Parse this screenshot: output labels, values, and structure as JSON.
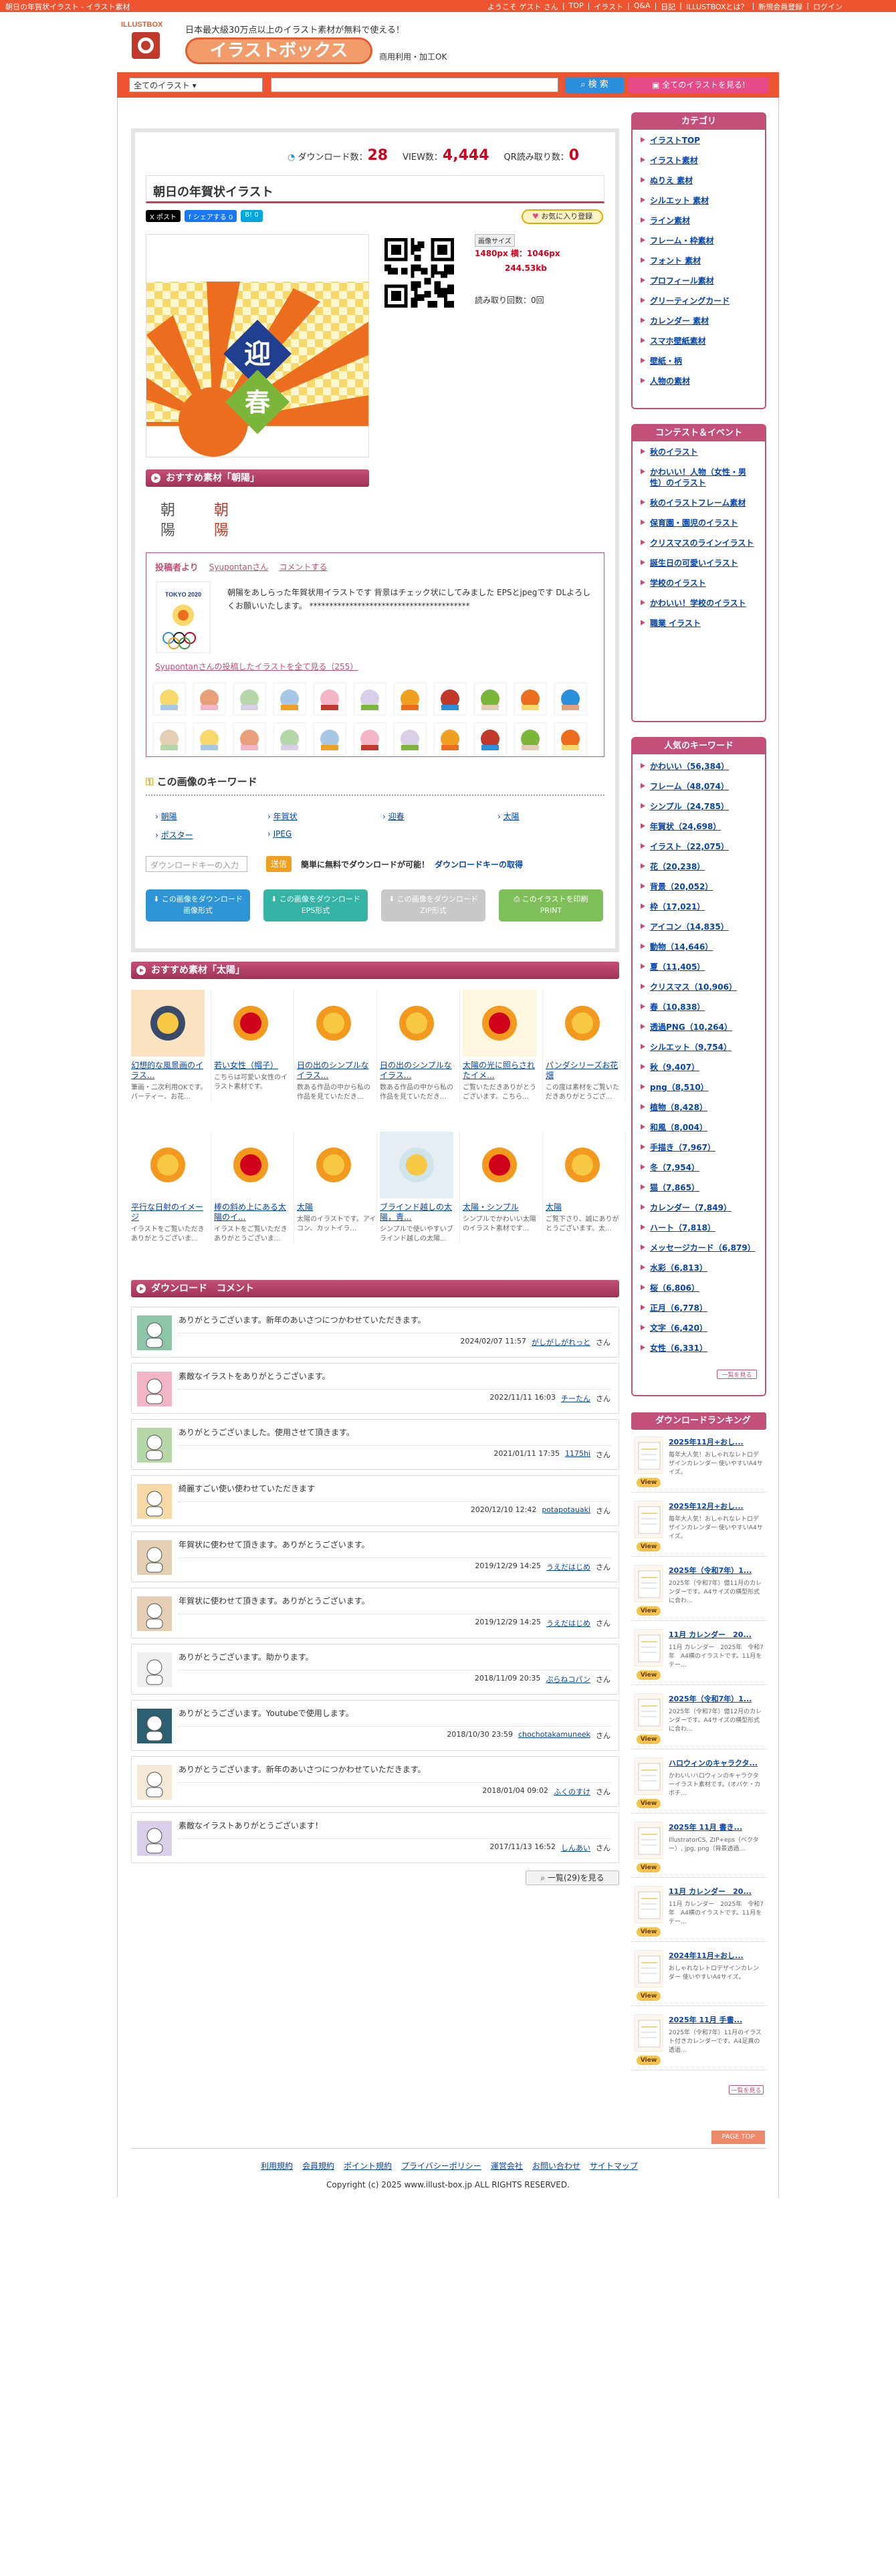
{
  "topbar": {
    "left": "朝日の年賀状イラスト - イラスト素材",
    "links": [
      "ようこそ ゲスト さん",
      "TOP",
      "イラスト",
      "Q&A",
      "日記",
      "ILLUSTBOXとは？",
      "新規会員登録",
      "ログイン"
    ]
  },
  "header": {
    "logo": "ILLUSTBOX",
    "tagline": "日本最大級30万点以上のイラスト素材が無料で使える！",
    "title": "イラストボックス",
    "sub": "商用利用・加工OK"
  },
  "search": {
    "category": "全てのイラスト",
    "button": "検 索",
    "see_all": "全てのイラストを見る!"
  },
  "stats": {
    "download_label": "ダウンロード数：",
    "download": "28",
    "view_label": "VIEW数：",
    "view": "4,444",
    "qr_label": "QR読み取り数：",
    "qr": "0"
  },
  "illustration": {
    "title": "朝日の年賀状イラスト",
    "fav": "お気に入り登録",
    "size_label": "画像サイズ",
    "size": "1480px 横：1046px",
    "kb": "244.53kb",
    "rank": "読み取り回数：0回",
    "img_text1": "迎",
    "img_text2": "春"
  },
  "social": [
    "X ポスト",
    "f シェアする 0",
    "B! 0"
  ],
  "recommend": {
    "title": "おすすめ素材「朝陽」"
  },
  "poster": {
    "title": "投稿者より",
    "name": "Syupontanさん",
    "comment_link": "コメントする",
    "text": "朝陽をあしらった年賀状用イラストです 背景はチェック状にしてみました EPSとjpegです DLよろしくお願いいたします。 ****************************************",
    "more": "Syupontanさんの投稿したイラストを全て見る（255）",
    "avatar_label": "TOKYO 2020"
  },
  "keywords": {
    "title": "この画像のキーワード",
    "items": [
      "朝陽",
      "年賀状",
      "迎春",
      "太陽",
      "ポスター",
      "JPEG"
    ],
    "input_placeholder": "ダウンロードキーの入力",
    "go": "送信",
    "note": "簡単に無料でダウンロードが可能！",
    "note_link": "ダウンロードキーの取得"
  },
  "downloads": [
    {
      "l1": "この画像をダウンロード",
      "l2": "画像形式",
      "c": "#2e96d6"
    },
    {
      "l1": "この画像をダウンロード",
      "l2": "EPS形式",
      "c": "#35b3a4"
    },
    {
      "l1": "この画像をダウンロード",
      "l2": "ZIP形式",
      "c": "#c8c8c8"
    },
    {
      "l1": "このイラストを印刷",
      "l2": "PRINT",
      "c": "#7fbf5a"
    }
  ],
  "sun": {
    "title": "おすすめ素材「太陽」",
    "cards": [
      {
        "t": "幻想的な風景画のイラス...",
        "d": "筆画・二次利用OKです。パーティー、お花..."
      },
      {
        "t": "若い女性（帽子）",
        "d": "こちらは可愛い女性のイラスト素材です。"
      },
      {
        "t": "日の出のシンプルなイラス...",
        "d": "数ある作品の中から私の作品を見ていただき..."
      },
      {
        "t": "日の出のシンプルなイラス...",
        "d": "数ある作品の中から私の作品を見ていただき..."
      },
      {
        "t": "太陽の光に照らされたイメ...",
        "d": "ご覧いただきありがとうございます。こちら..."
      },
      {
        "t": "パンダシリーズお花畑",
        "d": "この度は素材をご覧いただきありがとうござ..."
      },
      {
        "t": "平行な日射のイメージ",
        "d": "イラストをご覧いただきありがとうございま..."
      },
      {
        "t": "棒の斜め上にある太陽のイ...",
        "d": "イラストをご覧いただきありがとうございま..."
      },
      {
        "t": "太陽",
        "d": "太陽のイラストです。アイコン、カットイラ..."
      },
      {
        "t": "ブラインド越しの太陽，青...",
        "d": "シンプルで使いやすいブラインド越しの太陽..."
      },
      {
        "t": "太陽・シンプル",
        "d": "シンプルでかわいい太陽のイラスト素材です..."
      },
      {
        "t": "太陽",
        "d": "ご覧下さり、誠にありがとうございます。太..."
      }
    ]
  },
  "comments": {
    "title": "ダウンロード　コメント",
    "san": "さん",
    "more": "一覧(29)を見る",
    "items": [
      {
        "t": "ありがとうございます。新年のあいさつにつかわせていただきます。",
        "date": "2024/02/07 11:57",
        "u": "がしがしがれっと",
        "c": "#8cc5a8"
      },
      {
        "t": "素敵なイラストをありがとうございます。",
        "date": "2022/11/11 16:03",
        "u": "チーたん",
        "c": "#f4b5c6"
      },
      {
        "t": "ありがとうございました。使用させて頂きます。",
        "date": "2021/01/11 17:35",
        "u": "1175hi",
        "c": "#b6d7a8"
      },
      {
        "t": "綺麗すごい使い使わせていただきます",
        "date": "2020/12/10 12:42",
        "u": "potapotauaki",
        "c": "#f7d9a8"
      },
      {
        "t": "年賀状に使わせて頂きます。ありがとうございます。",
        "date": "2019/12/29 14:25",
        "u": "うえだはじめ",
        "c": "#e4cfb4"
      },
      {
        "t": "年賀状に使わせて頂きます。ありがとうございます。",
        "date": "2019/12/29 14:25",
        "u": "うえだはじめ",
        "c": "#e4cfb4"
      },
      {
        "t": "ありがとうございます。助かります。",
        "date": "2018/11/09 20:35",
        "u": "ぷらねコパン",
        "c": "#f0f0f0"
      },
      {
        "t": "ありがとうございます。Youtubeで使用します。",
        "date": "2018/10/30 23:59",
        "u": "chochotakamuneek",
        "c": "#2d5f73"
      },
      {
        "t": "ありがとうございます。新年のあいさつにつかわせていただきます。",
        "date": "2018/01/04 09:02",
        "u": "ふくのすけ",
        "c": "#f5e8d6"
      },
      {
        "t": "素敵なイラストありがとうございます！",
        "date": "2017/11/13 16:52",
        "u": "しんあい",
        "c": "#d9cfe8"
      }
    ]
  },
  "sidebar": {
    "category": {
      "title": "カテゴリ",
      "items": [
        "イラストTOP",
        "イラスト素材",
        "ぬりえ 素材",
        "シルエット 素材",
        "ライン素材",
        "フレーム・枠素材",
        "フォント 素材",
        "プロフィール素材",
        "グリーティングカード",
        "カレンダー 素材",
        "スマホ壁紙素材",
        "壁紙・柄",
        "人物の素材"
      ]
    },
    "events": {
      "title": "コンテスト＆イベント",
      "items": [
        "秋のイラスト",
        "かわいい！人物（女性・男性）のイラスト",
        "秋のイラストフレーム素材",
        "保育園・園児のイラスト",
        "クリスマスのラインイラスト",
        "誕生日の可愛いイラスト",
        "学校のイラスト",
        "かわいい！学校のイラスト",
        "職業 イラスト"
      ]
    },
    "popular": {
      "title": "人気のキーワード",
      "items": [
        "かわいい（56,384）",
        "フレーム（48,074）",
        "シンプル（24,785）",
        "年賀状（24,698）",
        "イラスト（22,075）",
        "花（20,238）",
        "背景（20,052）",
        "枠（17,021）",
        "アイコン（14,835）",
        "動物（14,646）",
        "夏（11,405）",
        "クリスマス（10,906）",
        "春（10,838）",
        "透過PNG（10,264）",
        "シルエット（9,754）",
        "秋（9,407）",
        "png（8,510）",
        "植物（8,428）",
        "和風（8,004）",
        "手描き（7,967）",
        "冬（7,954）",
        "猫（7,865）",
        "カレンダー（7,849）",
        "ハート（7,818）",
        "メッセージカード（6,879）",
        "水彩（6,813）",
        "桜（6,806）",
        "正月（6,778）",
        "文字（6,420）",
        "女性（6,331）"
      ],
      "more": "一覧を見る"
    },
    "ranking": {
      "title": "ダウンロードランキング",
      "view": "View",
      "more": "一覧を見る",
      "items": [
        {
          "t": "2025年11月+おし...",
          "d": "毎年大人気！おしゃれなレトロデザインカレンダー 使いやすいA4サイズ。"
        },
        {
          "t": "2025年12月+おし...",
          "d": "毎年大人気！おしゃれなレトロデザインカレンダー 使いやすいA4サイズ。"
        },
        {
          "t": "2025年（令和7年）1...",
          "d": "2025年（令和7年）億11月のカレンダーです。A4サイズの横型形式に合わ..."
        },
        {
          "t": "11月 カレンダー　20...",
          "d": "11月 カレンダー　2025年　令和7年　A4横のイラストです。11月をテー..."
        },
        {
          "t": "2025年（令和7年）1...",
          "d": "2025年（令和7年）億12月のカレンダーです。A4サイズの横型形式に合わ..."
        },
        {
          "t": "ハロウィンのキャラクタ...",
          "d": "かわいいハロウィンのキャラクターイラスト素材です。(オバケ・カボチ..."
        },
        {
          "t": "2025年 11月 書き...",
          "d": "IllustratorCS, ZIP+eps（ベクター）, jpg, png（背景透過..."
        },
        {
          "t": "11月 カレンダー　20...",
          "d": "11月 カレンダー　2025年　令和7年　A4横のイラストです。11月をテー..."
        },
        {
          "t": "2024年11月+おし...",
          "d": "おしゃれなレトロデザインカレンダー 使いやすいA4サイズ。"
        },
        {
          "t": "2025年 11月 手書...",
          "d": "2025年（令和7年）11月のイラスト付きカレンダーです。A4足真の透過..."
        }
      ]
    }
  },
  "footer": {
    "pagetop": "PAGE TOP",
    "links": [
      "利用規約",
      "会員規約",
      "ポイント規約",
      "プライバシーポリシー",
      "運営会社",
      "お問い合わせ",
      "サイトマップ"
    ],
    "copyright": "Copyright (c) 2025 www.illust-box.jp ALL RIGHTS RESERVED."
  }
}
